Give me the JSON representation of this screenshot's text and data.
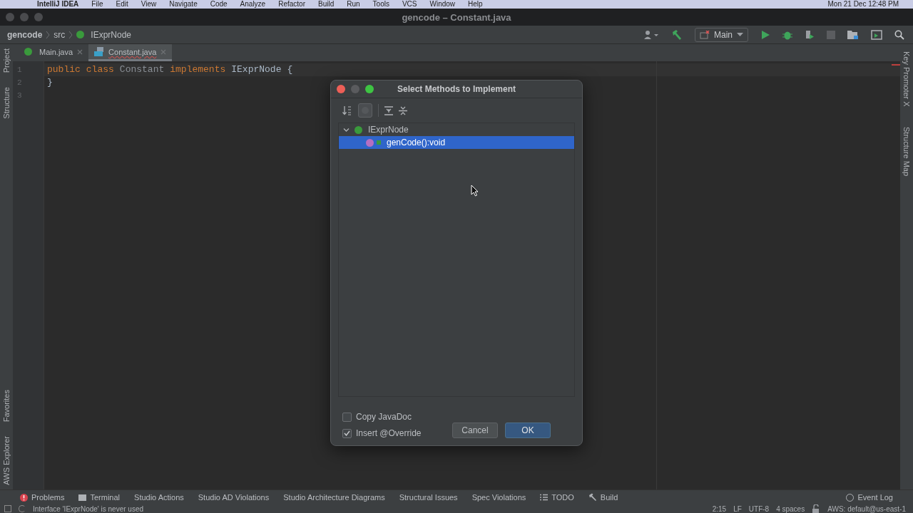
{
  "menu_bar": {
    "app": "IntelliJ IDEA",
    "items": [
      "File",
      "Edit",
      "View",
      "Navigate",
      "Code",
      "Analyze",
      "Refactor",
      "Build",
      "Run",
      "Tools",
      "VCS",
      "Window",
      "Help"
    ],
    "clock": "Mon 21 Dec  12:48 PM"
  },
  "window": {
    "title": "gencode – Constant.java"
  },
  "breadcrumbs": [
    {
      "label": "gencode",
      "kind": "project"
    },
    {
      "label": "src",
      "kind": "folder"
    },
    {
      "label": "IExprNode",
      "kind": "interface"
    }
  ],
  "run_config": "Main",
  "tabs": [
    {
      "label": "Main.java",
      "kind": "interface",
      "selected": false
    },
    {
      "label": "Constant.java",
      "kind": "class",
      "selected": true
    }
  ],
  "left_tools": {
    "top": [
      "Project",
      "Structure"
    ],
    "bottom": [
      "Favorites",
      "AWS Explorer"
    ]
  },
  "right_tools": [
    "Key Promoter X",
    "Structure Map"
  ],
  "editor": {
    "lines": [
      {
        "number": "1",
        "tokens": [
          {
            "text": "public",
            "kind": "keyword"
          },
          {
            "text": "class",
            "kind": "keyword"
          },
          {
            "text": "Constant",
            "kind": "unused"
          },
          {
            "text": "implements",
            "kind": "keyword"
          },
          {
            "text": "IExprNode",
            "kind": "plain"
          },
          {
            "text": "{",
            "kind": "plain"
          }
        ]
      },
      {
        "number": "2",
        "tokens": [
          {
            "text": "}",
            "kind": "plain"
          }
        ]
      },
      {
        "number": "3"
      }
    ]
  },
  "dialog": {
    "title": "Select Methods to Implement",
    "tree": [
      {
        "label": "IExprNode",
        "expanded": true,
        "selected": false,
        "children": [
          {
            "label": "genCode():void",
            "selected": true
          }
        ]
      }
    ],
    "options": [
      {
        "label": "Copy JavaDoc",
        "checked": false
      },
      {
        "label": "Insert @Override",
        "checked": true
      }
    ],
    "buttons": [
      {
        "label": "Cancel",
        "kind": "secondary"
      },
      {
        "label": "OK",
        "kind": "primary"
      }
    ]
  },
  "tool_windows": [
    {
      "label": "Problems",
      "kind": "problems"
    },
    {
      "label": "Terminal",
      "kind": "terminal"
    },
    {
      "label": "Studio Actions",
      "kind": "plain"
    },
    {
      "label": "Studio AD Violations",
      "kind": "plain"
    },
    {
      "label": "Studio Architecture Diagrams",
      "kind": "plain"
    },
    {
      "label": "Structural Issues",
      "kind": "plain"
    },
    {
      "label": "Spec Violations",
      "kind": "plain"
    },
    {
      "label": "TODO",
      "kind": "todo"
    },
    {
      "label": "Build",
      "kind": "build"
    }
  ],
  "event_log": "Event Log",
  "status_bar": {
    "message": "Interface 'IExprNode' is never used",
    "position": "2:15",
    "line_ending": "LF",
    "encoding": "UTF-8",
    "indent": "4 spaces",
    "aws": "AWS: default@us-east-1"
  }
}
